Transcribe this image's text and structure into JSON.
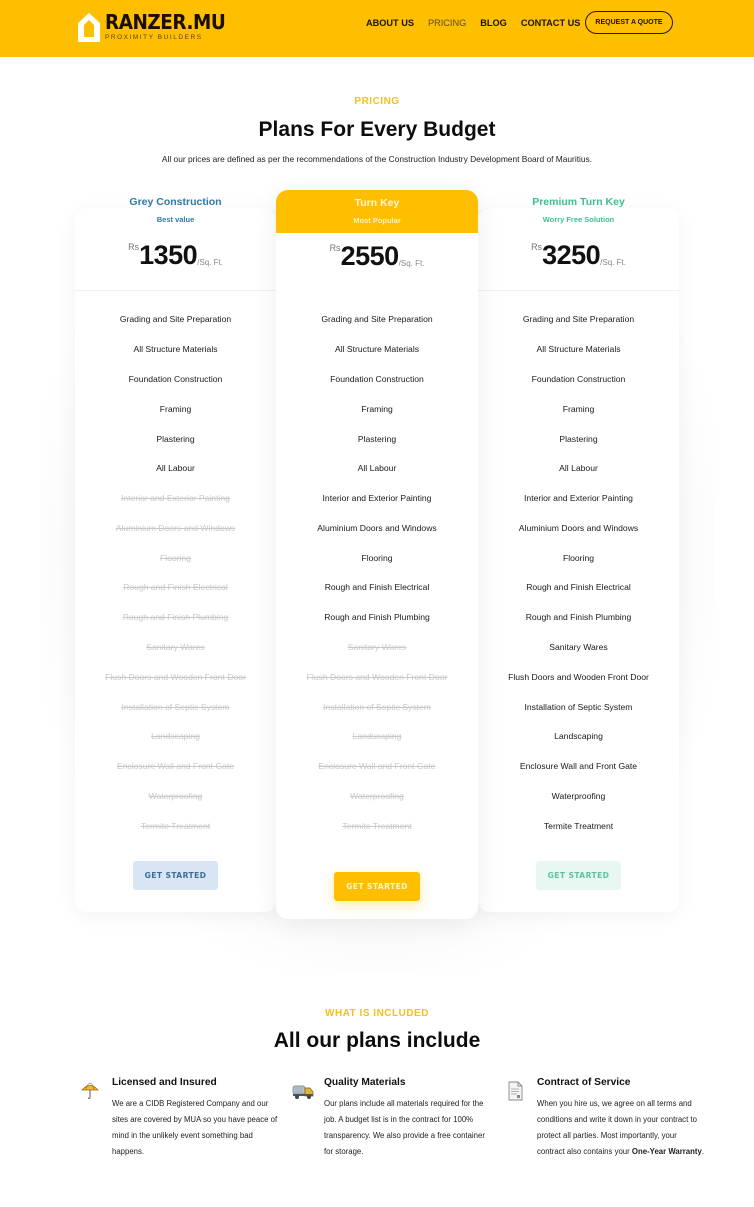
{
  "header": {
    "logo": {
      "name": "RANZER.MU",
      "tagline": "PROXIMITY BUILDERS",
      "icon": "house-icon"
    },
    "nav": [
      {
        "label": "ABOUT US",
        "active": false
      },
      {
        "label": "PRICING",
        "active": true
      },
      {
        "label": "BLOG",
        "active": false
      },
      {
        "label": "CONTACT US",
        "active": false
      }
    ],
    "cta_label": "REQUEST A QUOTE"
  },
  "pricing": {
    "eyebrow": "PRICING",
    "title": "Plans For Every Budget",
    "subtitle": "All our prices are defined as per the recommendations of the Construction Industry Development Board of Mauritius.",
    "plans": [
      {
        "name": "Grey Construction",
        "tag": "Best value",
        "accent": "#2f7aa6",
        "currency": "Rs",
        "price": "1350",
        "unit": "/Sq. Ft.",
        "button": "GET STARTED",
        "features": [
          {
            "label": "Grading and Site Preparation",
            "included": true
          },
          {
            "label": "All Structure Materials",
            "included": true
          },
          {
            "label": "Foundation Construction",
            "included": true
          },
          {
            "label": "Framing",
            "included": true
          },
          {
            "label": "Plastering",
            "included": true
          },
          {
            "label": "All Labour",
            "included": true
          },
          {
            "label": "Interior and Exterior Painting",
            "included": false
          },
          {
            "label": "Aluminium Doors and Windows",
            "included": false
          },
          {
            "label": "Flooring",
            "included": false
          },
          {
            "label": "Rough and Finish Electrical",
            "included": false
          },
          {
            "label": "Rough and Finish Plumbing",
            "included": false
          },
          {
            "label": "Sanitary Wares",
            "included": false
          },
          {
            "label": "Flush Doors and Wooden Front Door",
            "included": false
          },
          {
            "label": "Installation of Septic System",
            "included": false
          },
          {
            "label": "Landscaping",
            "included": false
          },
          {
            "label": "Enclosure Wall and Front Gate",
            "included": false
          },
          {
            "label": "Waterproofing",
            "included": false
          },
          {
            "label": "Termite Treatment",
            "included": false
          }
        ]
      },
      {
        "name": "Turn Key",
        "tag": "Most Popular",
        "accent": "#fdbf00",
        "currency": "Rs",
        "price": "2550",
        "unit": "/Sq. Ft.",
        "button": "GET STARTED",
        "features": [
          {
            "label": "Grading and Site Preparation",
            "included": true
          },
          {
            "label": "All Structure Materials",
            "included": true
          },
          {
            "label": "Foundation Construction",
            "included": true
          },
          {
            "label": "Framing",
            "included": true
          },
          {
            "label": "Plastering",
            "included": true
          },
          {
            "label": "All Labour",
            "included": true
          },
          {
            "label": "Interior and Exterior Painting",
            "included": true
          },
          {
            "label": "Aluminium Doors and Windows",
            "included": true
          },
          {
            "label": "Flooring",
            "included": true
          },
          {
            "label": "Rough and Finish Electrical",
            "included": true
          },
          {
            "label": "Rough and Finish Plumbing",
            "included": true
          },
          {
            "label": "Sanitary Wares",
            "included": false
          },
          {
            "label": "Flush Doors and Wooden Front Door",
            "included": false
          },
          {
            "label": "Installation of Septic System",
            "included": false
          },
          {
            "label": "Landscaping",
            "included": false
          },
          {
            "label": "Enclosure Wall and Front Gate",
            "included": false
          },
          {
            "label": "Waterproofing",
            "included": false
          },
          {
            "label": "Termite Treatment",
            "included": false
          }
        ]
      },
      {
        "name": "Premium Turn Key",
        "tag": "Worry Free Solution",
        "accent": "#3fbf8f",
        "currency": "Rs",
        "price": "3250",
        "unit": "/Sq. Ft.",
        "button": "GET STARTED",
        "features": [
          {
            "label": "Grading and Site Preparation",
            "included": true
          },
          {
            "label": "All Structure Materials",
            "included": true
          },
          {
            "label": "Foundation Construction",
            "included": true
          },
          {
            "label": "Framing",
            "included": true
          },
          {
            "label": "Plastering",
            "included": true
          },
          {
            "label": "All Labour",
            "included": true
          },
          {
            "label": "Interior and Exterior Painting",
            "included": true
          },
          {
            "label": "Aluminium Doors and Windows",
            "included": true
          },
          {
            "label": "Flooring",
            "included": true
          },
          {
            "label": "Rough and Finish Electrical",
            "included": true
          },
          {
            "label": "Rough and Finish Plumbing",
            "included": true
          },
          {
            "label": "Sanitary Wares",
            "included": true
          },
          {
            "label": "Flush Doors and Wooden Front Door",
            "included": true
          },
          {
            "label": "Installation of Septic System",
            "included": true
          },
          {
            "label": "Landscaping",
            "included": true
          },
          {
            "label": "Enclosure Wall and Front Gate",
            "included": true
          },
          {
            "label": "Waterproofing",
            "included": true
          },
          {
            "label": "Termite Treatment",
            "included": true
          }
        ]
      }
    ]
  },
  "included": {
    "eyebrow": "WHAT IS INCLUDED",
    "title": "All our plans include",
    "items": [
      {
        "icon": "umbrella-icon",
        "title": "Licensed and Insured",
        "text": "We are a CIDB Registered Company and our sites are covered by MUA so you have peace of mind in the unlikely event something bad happens.",
        "bold": ""
      },
      {
        "icon": "truck-icon",
        "title": "Quality Materials",
        "text": "Our plans include all materials required for the job. A budget list is in the contract for 100% transparency. We also provide a free container for storage.",
        "bold": ""
      },
      {
        "icon": "document-icon",
        "title": "Contract of Service",
        "text": "When you hire us, we agree on all terms and conditions and write it down in your contract to protect all parties. Most importantly, your contract also contains your ",
        "bold": "One-Year Warranty",
        "text_end": "."
      }
    ]
  },
  "colors": {
    "brand_yellow": "#fdbf00",
    "grey_plan": "#2f7aa6",
    "premium_plan": "#3fbf8f"
  }
}
